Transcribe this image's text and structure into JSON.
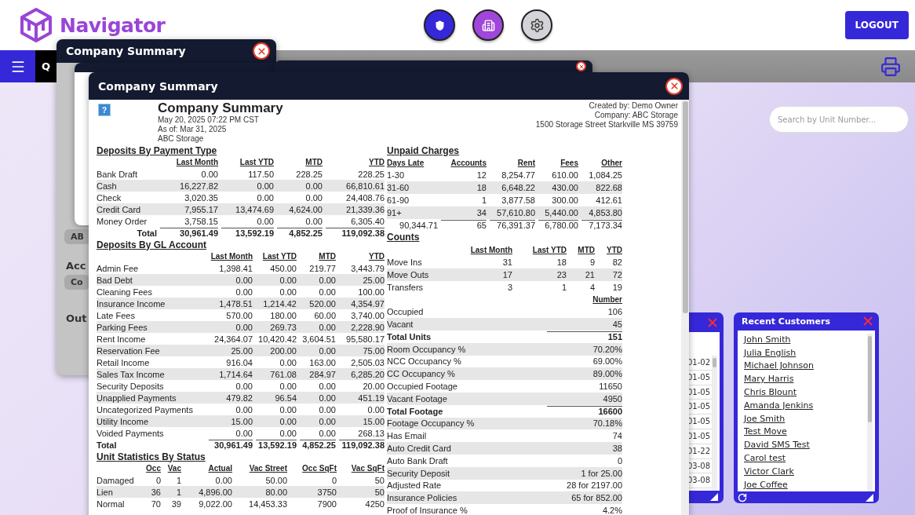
{
  "app": {
    "name": "Navigator",
    "logout": "LOGOUT"
  },
  "nav": {
    "tab": "Q"
  },
  "search": {
    "placeholder": "Search by Unit Number..."
  },
  "background_windows": [
    {
      "title": "Company Summary",
      "fragments": [
        "AB",
        "Acc",
        "Co",
        "Out"
      ]
    }
  ],
  "report_window": {
    "title": "Company Summary",
    "report": {
      "help": "?",
      "title": "Company Summary",
      "subtitle": [
        "May 20, 2025 07:22 PM CST",
        "As of: Mar 31, 2025",
        "ABC Storage"
      ],
      "meta": [
        "Created by: Demo Owner",
        "Company: ABC Storage",
        "1500 Storage Street Starkville MS 39759"
      ],
      "left_sections": [
        {
          "title": "Deposits By Payment Type",
          "columns": [
            "",
            "Last Month",
            "Last YTD",
            "MTD",
            "YTD"
          ],
          "rows": [
            {
              "kind": "row",
              "cells": [
                "Bank Draft",
                "0.00",
                "117.50",
                "228.25",
                "228.25"
              ]
            },
            {
              "kind": "row",
              "cells": [
                "Cash",
                "16,227.82",
                "0.00",
                "0.00",
                "66,810.61"
              ]
            },
            {
              "kind": "row",
              "cells": [
                "Check",
                "3,020.35",
                "0.00",
                "0.00",
                "24,408.76"
              ]
            },
            {
              "kind": "row",
              "cells": [
                "Credit Card",
                "7,955.17",
                "13,474.69",
                "4,624.00",
                "21,339.36"
              ]
            },
            {
              "kind": "row",
              "cells": [
                "Money Order",
                "3,758.15",
                "0.00",
                "0.00",
                "6,305.40"
              ]
            },
            {
              "kind": "total",
              "cells": [
                "Total",
                "30,961.49",
                "13,592.19",
                "4,852.25",
                "119,092.38"
              ]
            }
          ]
        },
        {
          "title": "Deposits By GL Account",
          "columns": [
            "",
            "Last Month",
            "Last YTD",
            "MTD",
            "YTD"
          ],
          "rows": [
            {
              "kind": "row",
              "cells": [
                "Admin Fee",
                "1,398.41",
                "450.00",
                "219.77",
                "3,443.79"
              ]
            },
            {
              "kind": "row",
              "cells": [
                "Bad Debt",
                "0.00",
                "0.00",
                "0.00",
                "25.00"
              ]
            },
            {
              "kind": "row",
              "cells": [
                "Cleaning Fees",
                "0.00",
                "0.00",
                "0.00",
                "100.00"
              ]
            },
            {
              "kind": "row",
              "cells": [
                "Insurance Income",
                "1,478.51",
                "1,214.42",
                "520.00",
                "4,354.97"
              ]
            },
            {
              "kind": "row",
              "cells": [
                "Late Fees",
                "570.00",
                "180.00",
                "60.00",
                "3,740.00"
              ]
            },
            {
              "kind": "row",
              "cells": [
                "Parking Fees",
                "0.00",
                "269.73",
                "0.00",
                "2,228.90"
              ]
            },
            {
              "kind": "row",
              "cells": [
                "Rent Income",
                "24,364.07",
                "10,420.42",
                "3,604.51",
                "95,580.17"
              ]
            },
            {
              "kind": "row",
              "cells": [
                "Reservation Fee",
                "25.00",
                "200.00",
                "0.00",
                "75.00"
              ]
            },
            {
              "kind": "row",
              "cells": [
                "Retail Income",
                "916.04",
                "0.00",
                "163.00",
                "2,505.03"
              ]
            },
            {
              "kind": "row",
              "cells": [
                "Sales Tax Income",
                "1,714.64",
                "761.08",
                "284.97",
                "6,285.20"
              ]
            },
            {
              "kind": "row",
              "cells": [
                "Security Deposits",
                "0.00",
                "0.00",
                "0.00",
                "20.00"
              ]
            },
            {
              "kind": "row",
              "cells": [
                "Unapplied Payments",
                "479.82",
                "96.54",
                "0.00",
                "451.19"
              ]
            },
            {
              "kind": "row",
              "cells": [
                "Uncategorized Payments",
                "0.00",
                "0.00",
                "0.00",
                "0.00"
              ]
            },
            {
              "kind": "row",
              "cells": [
                "Utility Income",
                "15.00",
                "0.00",
                "0.00",
                "15.00"
              ]
            },
            {
              "kind": "row",
              "cells": [
                "Voided Payments",
                "0.00",
                "0.00",
                "0.00",
                "268.13"
              ]
            },
            {
              "kind": "total",
              "cells": [
                "Total",
                "30,961.49",
                "13,592.19",
                "4,852.25",
                "119,092.38"
              ]
            }
          ]
        },
        {
          "title": "Unit Statistics By Status",
          "columns": [
            "",
            "Occ",
            "Vac",
            "Actual",
            "Vac Street",
            "Occ SqFt",
            "Vac SqFt"
          ],
          "rows": [
            {
              "kind": "row",
              "cells": [
                "Damaged",
                "0",
                "1",
                "0.00",
                "50.00",
                "0",
                "50"
              ]
            },
            {
              "kind": "row",
              "cells": [
                "Lien",
                "36",
                "1",
                "4,896.00",
                "80.00",
                "3750",
                "50"
              ]
            },
            {
              "kind": "row",
              "cells": [
                "Normal",
                "70",
                "39",
                "9,022.00",
                "14,453.33",
                "7900",
                "4250"
              ]
            }
          ]
        }
      ],
      "right_sections": [
        {
          "title": "Unpaid Charges",
          "columns": [
            "Days Late",
            "Accounts",
            "Rent",
            "Fees",
            "Other"
          ],
          "rows": [
            {
              "kind": "row",
              "cells": [
                "1-30",
                "12",
                "8,254.77",
                "610.00",
                "1,084.25"
              ]
            },
            {
              "kind": "row",
              "cells": [
                "31-60",
                "18",
                "6,648.22",
                "430.00",
                "822.68"
              ]
            },
            {
              "kind": "row",
              "cells": [
                "61-90",
                "1",
                "3,877.58",
                "300.00",
                "412.61"
              ]
            },
            {
              "kind": "row",
              "cells": [
                "91+",
                "34",
                "57,610.80",
                "5,440.00",
                "4,853.80"
              ]
            },
            {
              "kind": "total",
              "cells": [
                "90,344.71",
                "65",
                "76,391.37",
                "6,780.00",
                "7,173.34"
              ]
            }
          ]
        },
        {
          "title": "Counts",
          "columns": [
            "",
            "Last Month",
            "Last YTD",
            "MTD",
            "YTD"
          ],
          "rows": [
            {
              "kind": "row",
              "cells": [
                "Move Ins",
                "31",
                "18",
                "9",
                "82"
              ]
            },
            {
              "kind": "row",
              "cells": [
                "Move Outs",
                "17",
                "23",
                "21",
                "72"
              ]
            },
            {
              "kind": "row",
              "cells": [
                "Transfers",
                "3",
                "1",
                "4",
                "19"
              ]
            }
          ]
        },
        {
          "columns": [
            "",
            "Number"
          ],
          "rows": [
            {
              "kind": "row",
              "cells": [
                "Occupied",
                "106"
              ]
            },
            {
              "kind": "row",
              "cells": [
                "Vacant",
                "45"
              ]
            },
            {
              "kind": "total",
              "cells": [
                "Total Units",
                "151"
              ]
            },
            {
              "kind": "row",
              "cells": [
                "Room Occupancy %",
                "70.20%"
              ]
            },
            {
              "kind": "row",
              "cells": [
                "NCC Occupancy %",
                "69.00%"
              ]
            },
            {
              "kind": "row",
              "cells": [
                "CC Occupancy %",
                "89.00%"
              ]
            },
            {
              "kind": "row",
              "cells": [
                "Occupied Footage",
                "11650"
              ]
            },
            {
              "kind": "row",
              "cells": [
                "Vacant Footage",
                "4950"
              ]
            },
            {
              "kind": "total",
              "cells": [
                "Total Footage",
                "16600"
              ]
            },
            {
              "kind": "row",
              "cells": [
                "Footage Occupancy %",
                "70.18%"
              ]
            },
            {
              "kind": "row",
              "cells": [
                "Has Email",
                "74"
              ]
            },
            {
              "kind": "row",
              "cells": [
                "Auto Credit Card",
                "38"
              ]
            },
            {
              "kind": "row",
              "cells": [
                "Auto Bank Draft",
                "0"
              ]
            },
            {
              "kind": "row",
              "cells": [
                "Security Deposit",
                "1 for 25.00"
              ]
            },
            {
              "kind": "row",
              "cells": [
                "Adjusted Rate",
                "28 for 2197.00"
              ]
            },
            {
              "kind": "row",
              "cells": [
                "Insurance Policies",
                "65 for 852.00"
              ]
            },
            {
              "kind": "row",
              "cells": [
                "Proof of Insurance %",
                "4.2%"
              ]
            }
          ]
        }
      ]
    }
  },
  "dates_window": {
    "items": [
      "01-02",
      "01-05",
      "01-05",
      "01-05",
      "01-05",
      "01-05",
      "01-22",
      "03-08",
      "03-08"
    ]
  },
  "recent_customers": {
    "title": "Recent Customers",
    "items": [
      "John Smith",
      "Julia English",
      "Michael Johnson",
      "Mary Harris",
      "Chris Blount",
      "Amanda Jenkins",
      "Joe Smith",
      "Test Move",
      "David SMS Test",
      "Carol test",
      "Victor Clark",
      "Joe Coffee"
    ]
  }
}
